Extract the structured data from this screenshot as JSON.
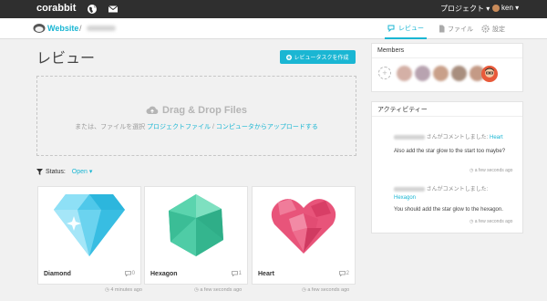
{
  "topbar": {
    "brand": "corabbit",
    "project_menu": "プロジェクト ▾",
    "user_menu": "ken ▾"
  },
  "subnav": {
    "site": "Website",
    "sep": "/",
    "tabs": [
      {
        "label": "レビュー",
        "icon": "chat-icon"
      },
      {
        "label": "ファイル",
        "icon": "file-icon"
      },
      {
        "label": "設定",
        "icon": "gear-icon"
      }
    ]
  },
  "main": {
    "title": "レビュー",
    "create_button": "レビュータスクを作成",
    "dropzone": {
      "title": "Drag & Drop Files",
      "prefix": "または、ファイルを選択 ",
      "link1": "プロジェクトファイル",
      "slash": " / ",
      "link2": "コンピュータからアップロードする"
    },
    "filter": {
      "label": "Status:",
      "value": "Open ▾"
    }
  },
  "cards": [
    {
      "name": "Diamond",
      "comments": "0",
      "time": "4 minutes ago"
    },
    {
      "name": "Hexagon",
      "comments": "1",
      "time": "a few seconds ago"
    },
    {
      "name": "Heart",
      "comments": "2",
      "time": "a few seconds ago"
    }
  ],
  "members": {
    "title": "Members",
    "add": "+"
  },
  "activity": {
    "title": "アクティビティー",
    "items": [
      {
        "meta": "さんがコメントしました: ",
        "target": "Heart",
        "body": "Also add the star glow to the start too maybe?",
        "time": "a few seconds ago"
      },
      {
        "meta": "さんがコメントしました: ",
        "target": "Hexagon",
        "body": "You should add the star glow to the hexagon.",
        "time": "a few seconds ago"
      }
    ]
  },
  "colors": {
    "accent": "#1ab6d3",
    "topbar": "#2f2f2f"
  }
}
